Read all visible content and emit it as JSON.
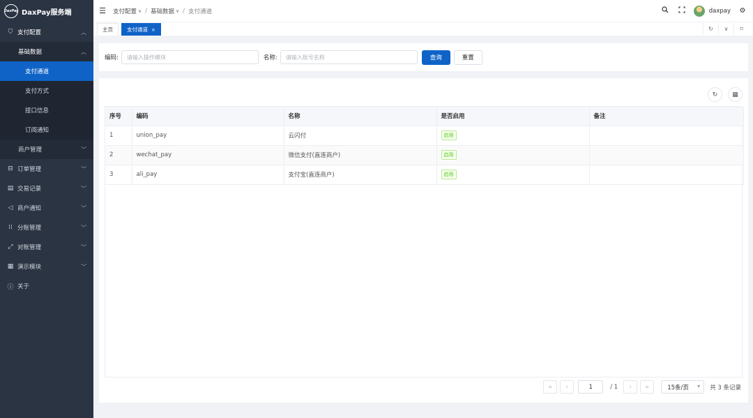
{
  "app": {
    "logo_mark": "DaxPay",
    "title": "DaxPay服务端"
  },
  "sidebar": {
    "items": [
      {
        "label": "支付配置",
        "icon": "shield-icon",
        "state": "open"
      },
      {
        "label": "基础数据",
        "level": 2,
        "state": "open"
      },
      {
        "label": "支付通道",
        "level": 3,
        "active": true
      },
      {
        "label": "支付方式",
        "level": 3
      },
      {
        "label": "接口信息",
        "level": 3
      },
      {
        "label": "订阅通知",
        "level": 3
      },
      {
        "label": "商户管理",
        "level": 2
      },
      {
        "label": "订单管理",
        "icon": "order-icon"
      },
      {
        "label": "交易记录",
        "icon": "document-icon"
      },
      {
        "label": "商户通知",
        "icon": "megaphone-icon"
      },
      {
        "label": "分账管理",
        "icon": "split-icon"
      },
      {
        "label": "对账管理",
        "icon": "reconcile-icon"
      },
      {
        "label": "演示模块",
        "icon": "grid-icon"
      },
      {
        "label": "关于",
        "icon": "info-icon"
      }
    ]
  },
  "header": {
    "breadcrumb": [
      "支付配置",
      "基础数据",
      "支付通道"
    ],
    "username": "daxpay"
  },
  "tabs": [
    {
      "label": "主页",
      "active": false
    },
    {
      "label": "支付通道",
      "active": true,
      "close": "×"
    }
  ],
  "search": {
    "code_label": "编码:",
    "code_placeholder": "请输入操作模块",
    "name_label": "名称:",
    "name_placeholder": "请输入账号名称",
    "query_button": "查询",
    "reset_button": "重置"
  },
  "table": {
    "columns": [
      "序号",
      "编码",
      "名称",
      "是否启用",
      "备注"
    ],
    "rows": [
      {
        "index": "1",
        "code": "union_pay",
        "name": "云闪付",
        "enabled": "启用",
        "remark": ""
      },
      {
        "index": "2",
        "code": "wechat_pay",
        "name": "微信支付(直连商户)",
        "enabled": "启用",
        "remark": ""
      },
      {
        "index": "3",
        "code": "ali_pay",
        "name": "支付宝(直连商户)",
        "enabled": "启用",
        "remark": ""
      }
    ]
  },
  "pager": {
    "current_page": "1",
    "total_pages": "/ 1",
    "page_size": "15条/页",
    "total": "共 3 条记录"
  },
  "colors": {
    "primary": "#0f63c7",
    "sidebar_bg": "#2b3443",
    "tag_green": "#52c41a"
  }
}
